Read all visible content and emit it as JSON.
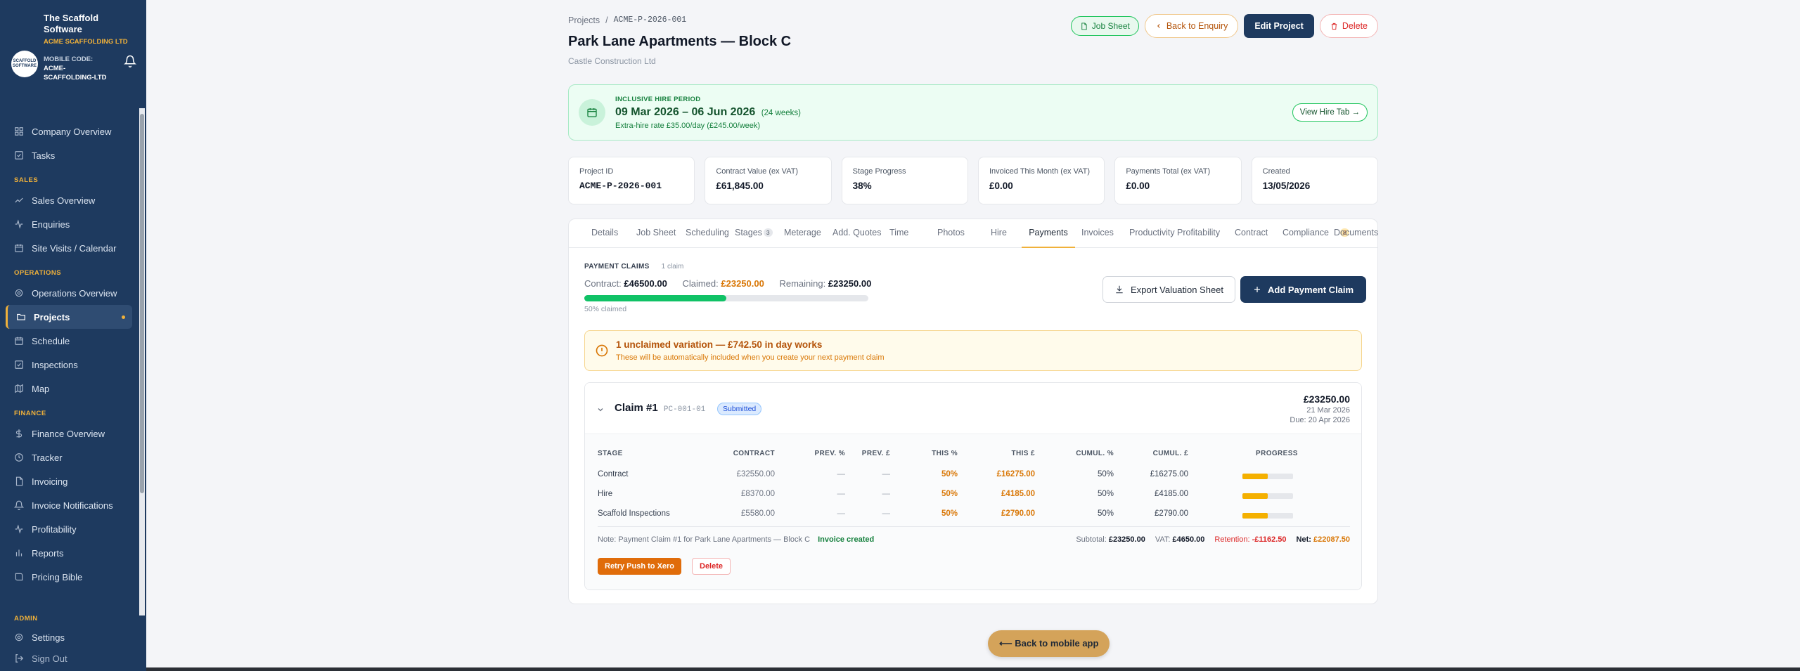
{
  "brand": {
    "title": "The Scaffold Software",
    "logo_text": "SCAFFOLD SOFTWARE",
    "company": "ACME SCAFFOLDING LTD",
    "mobile_label": "MOBILE CODE:",
    "mobile_code": "ACME-SCAFFOLDING-LTD"
  },
  "sidebar": {
    "top_items": [
      {
        "label": "Company Overview",
        "icon": "grid-icon"
      },
      {
        "label": "Tasks",
        "icon": "checkbox-icon"
      }
    ],
    "sections": [
      {
        "title": "SALES",
        "items": [
          {
            "label": "Sales Overview",
            "icon": "trend-icon"
          },
          {
            "label": "Enquiries",
            "icon": "activity-icon"
          },
          {
            "label": "Site Visits / Calendar",
            "icon": "calendar-icon"
          }
        ]
      },
      {
        "title": "OPERATIONS",
        "items": [
          {
            "label": "Operations Overview",
            "icon": "gear-icon"
          },
          {
            "label": "Projects",
            "icon": "folder-icon",
            "active": true
          },
          {
            "label": "Schedule",
            "icon": "calendar-icon"
          },
          {
            "label": "Inspections",
            "icon": "checkbox-icon"
          },
          {
            "label": "Map",
            "icon": "map-icon"
          }
        ]
      },
      {
        "title": "FINANCE",
        "items": [
          {
            "label": "Finance Overview",
            "icon": "dollar-icon"
          },
          {
            "label": "Tracker",
            "icon": "clock-icon"
          },
          {
            "label": "Invoicing",
            "icon": "document-icon"
          },
          {
            "label": "Invoice Notifications",
            "icon": "bell-icon"
          },
          {
            "label": "Profitability",
            "icon": "activity-icon"
          },
          {
            "label": "Reports",
            "icon": "bar-chart-icon"
          },
          {
            "label": "Pricing Bible",
            "icon": "book-icon"
          }
        ]
      }
    ],
    "admin_title": "ADMIN",
    "settings_label": "Settings",
    "signout_label": "Sign Out"
  },
  "breadcrumb": {
    "parent": "Projects",
    "separator": "/",
    "current": "ACME-P-2026-001"
  },
  "project": {
    "title": "Park Lane Apartments — Block C",
    "client": "Castle Construction Ltd"
  },
  "actions": {
    "job_sheet": "Job Sheet",
    "back": "Back to Enquiry",
    "edit": "Edit Project",
    "delete": "Delete"
  },
  "hire": {
    "label": "INCLUSIVE HIRE PERIOD",
    "dates": "09 Mar 2026 – 06 Jun 2026",
    "weeks": "(24 weeks)",
    "rate": "Extra-hire rate £35.00/day (£245.00/week)",
    "view_button": "View Hire Tab →"
  },
  "stats": [
    {
      "label": "Project ID",
      "value": "ACME-P-2026-001",
      "mono": true
    },
    {
      "label": "Contract Value (ex VAT)",
      "value": "£61,845.00"
    },
    {
      "label": "Stage Progress",
      "value": "38%"
    },
    {
      "label": "Invoiced This Month (ex VAT)",
      "value": "£0.00"
    },
    {
      "label": "Payments Total (ex VAT)",
      "value": "£0.00"
    },
    {
      "label": "Created",
      "value": "13/05/2026"
    }
  ],
  "tabs": [
    {
      "label": "Details"
    },
    {
      "label": "Job Sheet"
    },
    {
      "label": "Scheduling"
    },
    {
      "label": "Stages",
      "badge": "3"
    },
    {
      "label": "Meterage"
    },
    {
      "label": "Add. Quotes"
    },
    {
      "label": "Time"
    },
    {
      "label": "Photos"
    },
    {
      "label": "Hire"
    },
    {
      "label": "Payments",
      "active": true
    },
    {
      "label": "Invoices"
    },
    {
      "label": "Productivity"
    },
    {
      "label": "Profitability"
    },
    {
      "label": "Contract"
    },
    {
      "label": "Compliance",
      "badge": "8"
    },
    {
      "label": "Documents"
    }
  ],
  "claims": {
    "heading": "PAYMENT CLAIMS",
    "count": "1 claim",
    "contract_label": "Contract:",
    "contract_value": "£46500.00",
    "claimed_label": "Claimed:",
    "claimed_value": "£23250.00",
    "remaining_label": "Remaining:",
    "remaining_value": "£23250.00",
    "progress_fraction": 0.5,
    "progress_text": "50% claimed",
    "export_label": "Export Valuation Sheet",
    "add_label": "Add Payment Claim"
  },
  "variation": {
    "title": "1 unclaimed variation — £742.50 in day works",
    "subtitle": "These will be automatically included when you create your next payment claim"
  },
  "claim": {
    "name": "Claim #1",
    "code": "PC-001-01",
    "status": "Submitted",
    "total": "£23250.00",
    "date": "21 Mar 2026",
    "due": "Due: 20 Apr 2026",
    "columns": [
      "STAGE",
      "CONTRACT",
      "PREV. %",
      "PREV. £",
      "THIS %",
      "THIS £",
      "CUMUL. %",
      "CUMUL. £",
      "PROGRESS"
    ],
    "rows": [
      {
        "stage": "Contract",
        "contract": "£32550.00",
        "prev_pct": "—",
        "prev_gbp": "—",
        "this_pct": "50%",
        "this_gbp": "£16275.00",
        "cum_pct": "50%",
        "cum_gbp": "£16275.00",
        "progress": 0.5
      },
      {
        "stage": "Hire",
        "contract": "£8370.00",
        "prev_pct": "—",
        "prev_gbp": "—",
        "this_pct": "50%",
        "this_gbp": "£4185.00",
        "cum_pct": "50%",
        "cum_gbp": "£4185.00",
        "progress": 0.5
      },
      {
        "stage": "Scaffold Inspections",
        "contract": "£5580.00",
        "prev_pct": "—",
        "prev_gbp": "—",
        "this_pct": "50%",
        "this_gbp": "£2790.00",
        "cum_pct": "50%",
        "cum_gbp": "£2790.00",
        "progress": 0.5
      }
    ],
    "note": "Note: Payment Claim #1 for Park Lane Apartments — Block C",
    "invoice_status": "Invoice created",
    "subtotal_label": "Subtotal:",
    "subtotal": "£23250.00",
    "vat_label": "VAT:",
    "vat": "£4650.00",
    "retention_label": "Retention:",
    "retention": "-£1162.50",
    "net_label": "Net:",
    "net": "£22087.50",
    "retry_label": "Retry Push to Xero",
    "delete_label": "Delete"
  },
  "mobile_button": "⟵ Back to mobile app",
  "colors": {
    "sidebar": "#1e3a5f",
    "accent": "#f0b13a",
    "success": "#10c266",
    "amber": "#d97706"
  }
}
